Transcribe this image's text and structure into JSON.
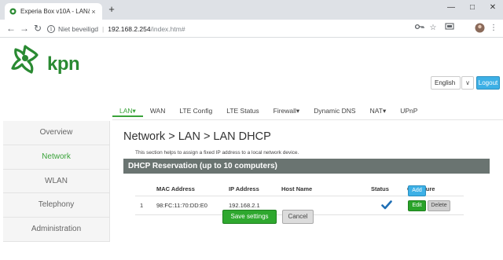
{
  "browser": {
    "tab_title": "Experia Box v10A - LAN&nbsp;&",
    "tab_close": "×",
    "new_tab": "+",
    "url_security": "Niet beveiligd",
    "url_host": "192.168.2.254",
    "url_path": "/index.htm#",
    "icons": [
      "back-icon",
      "forward-icon",
      "reload-icon",
      "info-icon",
      "key-icon",
      "star-icon",
      "cast-icon",
      "profile-icon",
      "menu-icon"
    ]
  },
  "header": {
    "logo_text": "kpn",
    "language": "English",
    "logout": "Logout"
  },
  "topnav": [
    {
      "label": "LAN",
      "active": true,
      "dropdown": true
    },
    {
      "label": "WAN"
    },
    {
      "label": "LTE Config"
    },
    {
      "label": "LTE Status"
    },
    {
      "label": "Firewall",
      "dropdown": true
    },
    {
      "label": "Dynamic DNS"
    },
    {
      "label": "NAT",
      "dropdown": true
    },
    {
      "label": "UPnP"
    }
  ],
  "topnav_labels": {
    "lan": "LAN▾",
    "wan": "WAN",
    "lte_config": "LTE Config",
    "lte_status": "LTE Status",
    "firewall": "Firewall▾",
    "ddns": "Dynamic DNS",
    "nat": "NAT▾",
    "upnp": "UPnP"
  },
  "sidebar": {
    "items": [
      {
        "label": "Overview"
      },
      {
        "label": "Network",
        "active": true
      },
      {
        "label": "WLAN"
      },
      {
        "label": "Telephony"
      },
      {
        "label": "Administration"
      }
    ]
  },
  "main": {
    "title": "Network > LAN > LAN DHCP",
    "description": "This section helps to assign a fixed IP address to a local network device.",
    "panel_title": "DHCP Reservation (up to 10 computers)",
    "table": {
      "headers": [
        "MAC Address",
        "IP Address",
        "Host Name",
        "Status",
        "Configure"
      ],
      "rows": [
        {
          "index": "1",
          "mac": "98:FC:11:70:DD:E0",
          "ip": "192.168.2.1",
          "host": "",
          "status": "enabled"
        }
      ]
    },
    "edit_label": "Edit",
    "delete_label": "Delete",
    "add_label": "Add",
    "save_label": "Save settings",
    "cancel_label": "Cancel"
  },
  "colors": {
    "brand_green": "#2a8a32",
    "accent_green": "#3aa33a",
    "accent_blue": "#3db0e6",
    "panel_gray": "#6a7471"
  }
}
